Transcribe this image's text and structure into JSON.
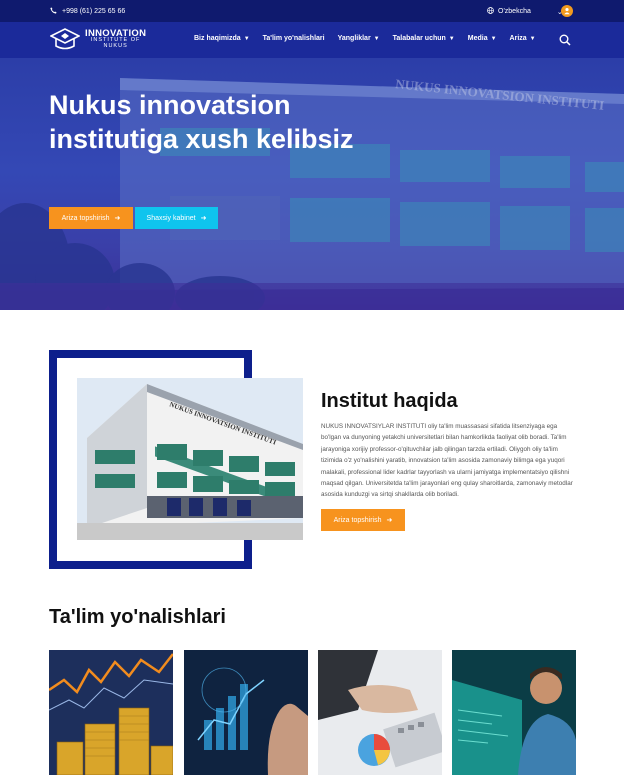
{
  "topbar": {
    "phone": "+998 (61) 225 65 66",
    "phone_icon": "phone-icon",
    "language": "O'zbekcha",
    "globe_icon": "globe-icon",
    "user_icon": "user-icon"
  },
  "nav": {
    "logo": {
      "line1": "INNOVATION",
      "line2": "INSTITUTE OF",
      "line3": "NUKUS"
    },
    "menu": [
      {
        "label": "Biz haqimizda",
        "dropdown": true
      },
      {
        "label": "Ta'lim yo'nalishlari",
        "dropdown": false
      },
      {
        "label": "Yangliklar",
        "dropdown": true
      },
      {
        "label": "Talabalar uchun",
        "dropdown": true
      },
      {
        "label": "Media",
        "dropdown": true
      },
      {
        "label": "Ariza",
        "dropdown": true
      }
    ],
    "search_icon": "search-icon"
  },
  "hero": {
    "title": "Nukus innovatsion institutiga xush kelibsiz",
    "building_sign": "NUKUS INNOVATSION INSTITUTI",
    "btn_apply": "Ariza topshirish",
    "btn_cabinet": "Shaxsiy kabinet"
  },
  "about": {
    "title": "Institut haqida",
    "building_sign": "NUKUS INNOVATSION INSTITUTI",
    "text": "NUKUS INNOVATSIYLAR INSTITUTI oliy ta'lim muassasasi sifatida litsenziyaga ega bo'lgan va dunyoning yetakchi universitetlari bilan hamkorlikda faoliyat olib boradi. Ta'lim jarayoniga xorijiy professor-o'qituvchilar jalb qilingan tarzda ertiladi. Oliygoh oliy ta'lim tizimida o'z yo'nalishini yaratib, innovatsion ta'lim asosida zamonaviy bilimga ega yuqori malakali, professional lider kadrlar tayyorlash va ularni jamiyatga implementatsiyo qilishni maqsad qilgan. Universitetda ta'lim jarayonlari eng qulay sharoitlarda, zamonaviy metodlar asosida kunduzgi va sirtqi shakllarda olib boriladi.",
    "btn": "Ariza topshirish"
  },
  "courses": {
    "title": "Ta'lim yo'nalishlari",
    "cards": [
      "finance-coins-chart",
      "digital-business-hand",
      "calculator-charts",
      "programmer-screen"
    ]
  },
  "colors": {
    "topbar": "#0f1a6e",
    "nav": "#1b2a9a",
    "accent_orange": "#f7931e",
    "accent_cyan": "#0fc4ee",
    "frame_blue": "#0d1f8c"
  }
}
